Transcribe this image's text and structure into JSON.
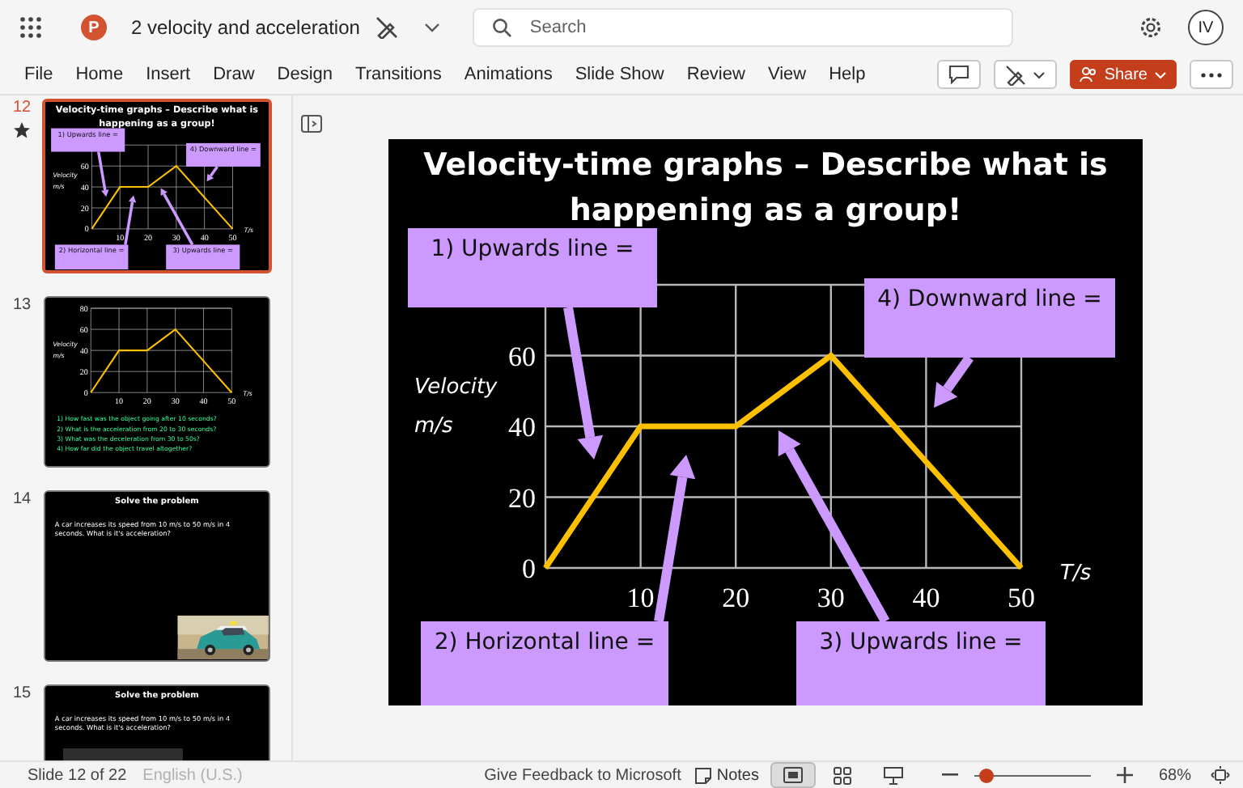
{
  "app": {
    "logo": "P",
    "title": "2 velocity and acceleration",
    "search": {
      "placeholder": "Search"
    },
    "avatar": "IV"
  },
  "ribbon_tabs": [
    "File",
    "Home",
    "Insert",
    "Draw",
    "Design",
    "Transitions",
    "Animations",
    "Slide Show",
    "Review",
    "View",
    "Help"
  ],
  "ribbon_actions": {
    "share": "Share"
  },
  "thumbnails": [
    {
      "number": "12",
      "selected": true,
      "starred": true,
      "slide": {
        "kind": "callout_graph",
        "title": "Velocity-time graphs – Describe what is happening as a group!",
        "callouts": [
          "1) Upwards line =",
          "4) Downward line =",
          "2) Horizontal line =",
          "3) Upwards line ="
        ],
        "chart_data": {
          "type": "line",
          "grid": true,
          "xlabel": "T/s",
          "ylabel": "Velocity m/s",
          "x": [
            0,
            10,
            20,
            30,
            40,
            50
          ],
          "series": [
            {
              "color": "#ffc000",
              "values": [
                0,
                40,
                40,
                60,
                30,
                0
              ]
            }
          ],
          "xlim": [
            0,
            50
          ],
          "ylim": [
            0,
            80
          ],
          "xticks": [
            10,
            20,
            30,
            40,
            50
          ],
          "yticks": [
            0,
            20,
            40,
            60
          ]
        }
      }
    },
    {
      "number": "13",
      "selected": false,
      "starred": false,
      "slide": {
        "kind": "question_graph",
        "questions": [
          "1) How fast was the object going after 10 seconds?",
          "2) What is the acceleration from 20 to 30 seconds?",
          "3) What was the deceleration from 30 to 50s?",
          "4) How far did the object travel altogether?"
        ],
        "chart_data": {
          "type": "line",
          "grid": true,
          "xlabel": "T/s",
          "ylabel": "Velocity m/s",
          "x": [
            0,
            10,
            20,
            30,
            40,
            50
          ],
          "series": [
            {
              "color": "#ffc000",
              "values": [
                0,
                40,
                40,
                60,
                30,
                0
              ]
            }
          ],
          "xlim": [
            0,
            50
          ],
          "ylim": [
            0,
            80
          ],
          "xticks": [
            10,
            20,
            30,
            40,
            50
          ],
          "yticks": [
            0,
            20,
            40,
            60,
            80
          ]
        }
      }
    },
    {
      "number": "14",
      "selected": false,
      "starred": false,
      "slide": {
        "kind": "problem",
        "title": "Solve the problem",
        "text": "A car increases its speed from 10 m/s to 50 m/s in 4 seconds. What is it's acceleration?"
      }
    },
    {
      "number": "15",
      "selected": false,
      "starred": false,
      "slide": {
        "kind": "problem",
        "title": "Solve the problem",
        "text": "A car increases its speed from 10 m/s to 50 m/s in 4 seconds. What is it's acceleration?",
        "formula_box": true
      }
    }
  ],
  "slide": {
    "kind": "callout_graph",
    "title": "Velocity-time graphs – Describe what is happening as a group!",
    "callouts": [
      "1) Upwards line =",
      "4) Downward line =",
      "2) Horizontal line =",
      "3) Upwards line ="
    ],
    "chart_data": {
      "type": "line",
      "grid": true,
      "xlabel": "T/s",
      "ylabel": "Velocity m/s",
      "x": [
        0,
        10,
        20,
        30,
        40,
        50
      ],
      "series": [
        {
          "color": "#ffc000",
          "values": [
            0,
            40,
            40,
            60,
            30,
            0
          ]
        }
      ],
      "xlim": [
        0,
        50
      ],
      "ylim": [
        0,
        80
      ],
      "xticks": [
        10,
        20,
        30,
        40,
        50
      ],
      "yticks": [
        0,
        20,
        40,
        60
      ]
    }
  },
  "status_bar": {
    "slide_info": "Slide 12 of 22",
    "language": "English (U.S.)",
    "feedback": "Give Feedback to Microsoft",
    "notes": "Notes",
    "views": [
      {
        "kind": "normal",
        "selected": true
      },
      {
        "kind": "sorter",
        "selected": false
      },
      {
        "kind": "presenter",
        "selected": false
      }
    ],
    "zoom": {
      "level": 0.1,
      "reading": "68%"
    }
  }
}
